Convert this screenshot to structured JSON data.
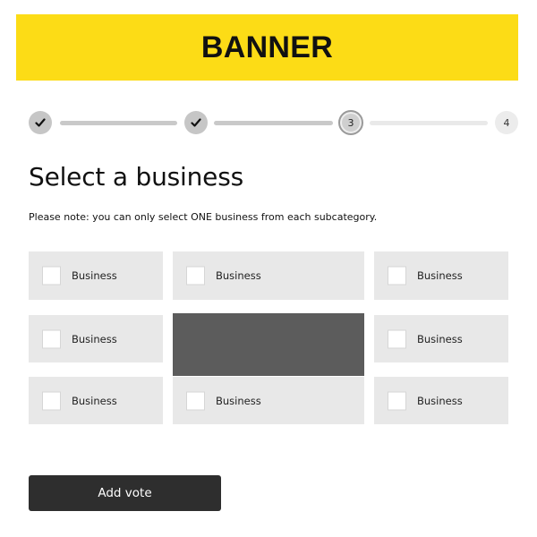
{
  "banner": {
    "text": "BANNER",
    "color": "#fcdc16"
  },
  "stepper": {
    "steps": [
      {
        "label": "",
        "state": "done",
        "icon": "check-icon"
      },
      {
        "label": "",
        "state": "done",
        "icon": "check-icon"
      },
      {
        "label": "3",
        "state": "current"
      },
      {
        "label": "4",
        "state": "future"
      }
    ]
  },
  "page": {
    "title": "Select a business",
    "note": "Please note: you can only select ONE business from each subcategory."
  },
  "businesses": [
    {
      "label": "Business"
    },
    {
      "label": "Business"
    },
    {
      "label": "Business"
    },
    {
      "label": "Business"
    },
    {
      "label": "Business"
    },
    {
      "label": "Business"
    },
    {
      "label": "Business"
    },
    {
      "label": "Business"
    }
  ],
  "actions": {
    "add_vote": "Add vote"
  }
}
